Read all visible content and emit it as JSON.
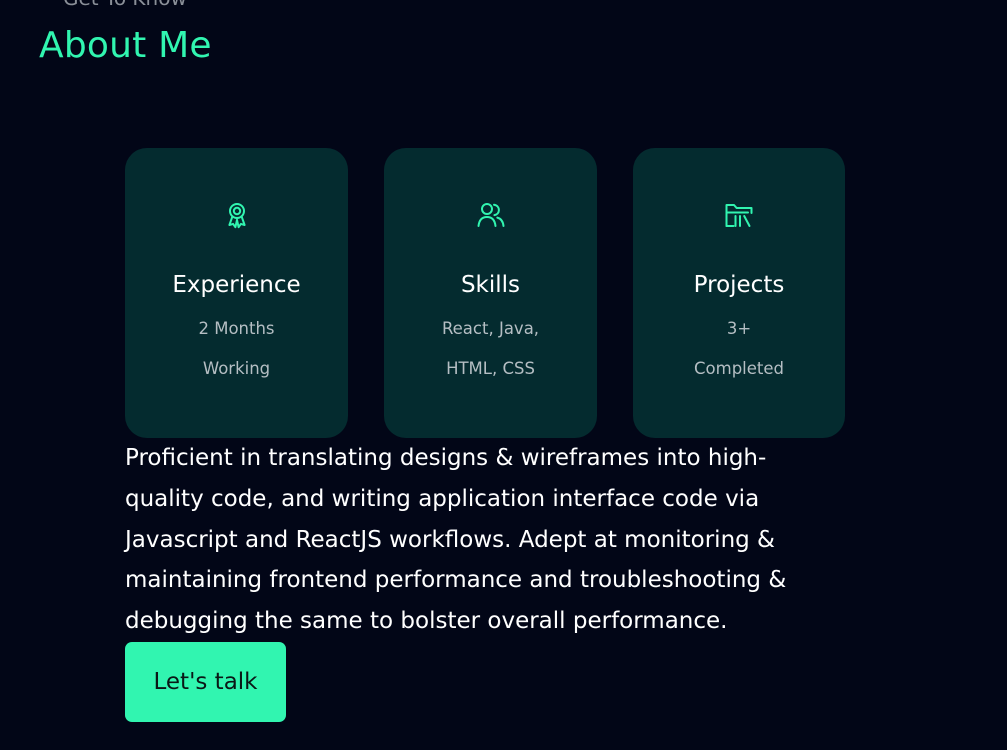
{
  "section": {
    "eyebrow": "Get To Know",
    "title": "About Me"
  },
  "cards": [
    {
      "icon": "award-icon",
      "title": "Experience",
      "line1": "2 Months",
      "line2": "Working"
    },
    {
      "icon": "users-icon",
      "title": "Skills",
      "line1": "React, Java,",
      "line2": "HTML, CSS"
    },
    {
      "icon": "folder-library-icon",
      "title": "Projects",
      "line1": "3+",
      "line2": "Completed"
    }
  ],
  "bio": {
    "text": "Proficient in translating designs & wireframes into high-quality code, and writing application interface code via Javascript and ReactJS workflows. Adept at monitoring & maintaining frontend performance and troubleshooting & debugging the same to bolster overall performance."
  },
  "cta": {
    "label": "Let's talk"
  },
  "colors": {
    "background": "#020617",
    "accent": "#31f5b0",
    "card": "#042b2f",
    "muted_text": "#b5bec3"
  }
}
